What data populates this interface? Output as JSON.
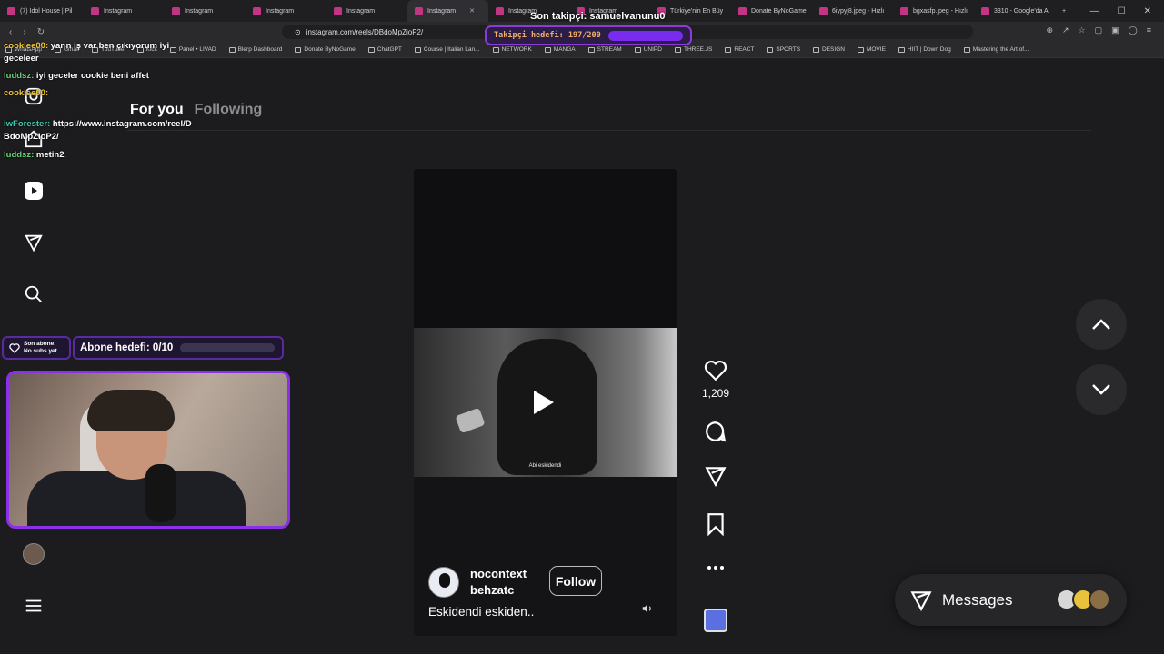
{
  "browser": {
    "tabs": [
      {
        "label": "(7) Idol House | Pil",
        "active": false
      },
      {
        "label": "Instagram",
        "active": false
      },
      {
        "label": "Instagram",
        "active": false
      },
      {
        "label": "Instagram",
        "active": false
      },
      {
        "label": "Instagram",
        "active": false
      },
      {
        "label": "Instagram",
        "active": true
      },
      {
        "label": "Instagram",
        "active": false
      },
      {
        "label": "Instagram",
        "active": false
      },
      {
        "label": "Türkiye'nin En Büy",
        "active": false
      },
      {
        "label": "Donate ByNoGame",
        "active": false
      },
      {
        "label": "6iypyj8.jpeg - Hızlı",
        "active": false
      },
      {
        "label": "bgxasfp.jpeg - Hızlı",
        "active": false
      },
      {
        "label": "3310 - Google'da A",
        "active": false
      }
    ],
    "new_tab": "+",
    "url": "instagram.com/reels/DBdoMpZioP2/",
    "bookmarks": [
      "WhatsApp",
      "Gmail",
      "YouTube",
      "Kick",
      "Panel • LIVAD",
      "Blerp Dashboard",
      "Donate ByNoGame",
      "ChatGPT",
      "Course | Italian Lan...",
      "NETWORK",
      "MANGA",
      "STREAM",
      "UNIPD",
      "THREE.JS",
      "REACT",
      "SPORTS",
      "DESIGN",
      "MOVIE",
      "HIIT | Down Dog",
      "Mastering the Art of..."
    ]
  },
  "feed": {
    "tabs": [
      {
        "label": "For you",
        "active": true
      },
      {
        "label": "Following",
        "active": false
      }
    ]
  },
  "reel": {
    "subtitle": "Abi eskidendi",
    "author": {
      "line1": "nocontext",
      "line2": "behzatc"
    },
    "follow_label": "Follow",
    "description": "Eskidendi eskiden..",
    "likes": "1,209"
  },
  "messages": {
    "label": "Messages"
  },
  "overlay": {
    "last_follower": "Son takipçi: samuelvanunu0",
    "follower_goal": "Takipçi hedefi: 197/200",
    "follower_goal_progress": 0.985,
    "chat": [
      {
        "user": "cookiee00:",
        "text": " yarın iş var ben çıkıyorum iyi",
        "color": "#f0c43a"
      },
      {
        "user": "",
        "text": "geceleer",
        "color": "#f0c43a"
      },
      {
        "user": "luddsz:",
        "text": " iyi geceler cookie beni affet",
        "color": "#69d07a"
      },
      {
        "user": "cookiee00:",
        "text": "",
        "color": "#f0c43a"
      },
      {
        "user": "iwForester:",
        "text": " https://www.instagram.com/reel/D",
        "color": "#3ec7b0"
      },
      {
        "user": "",
        "text": "BdoMpZioP2/",
        "color": "#3ec7b0"
      },
      {
        "user": "luddsz:",
        "text": " metin2",
        "color": "#69d07a"
      }
    ],
    "sub_last": {
      "line1": "Son abone:",
      "line2": "No subs yet"
    },
    "sub_goal": "Abone hedefi: 0/10",
    "sub_goal_progress": 0
  },
  "colors": {
    "background": "#1c1c1e",
    "overlay_purple": "#8a30e8",
    "goal_text": "#f1b06a"
  },
  "icons": {
    "sidebar": [
      "instagram-icon",
      "home-icon",
      "reels-icon",
      "explore-icon",
      "search-icon",
      "profile-avatar",
      "menu-icon"
    ],
    "actions": [
      "heart-icon",
      "comment-icon",
      "share-icon",
      "bookmark-icon",
      "more-icon"
    ]
  }
}
